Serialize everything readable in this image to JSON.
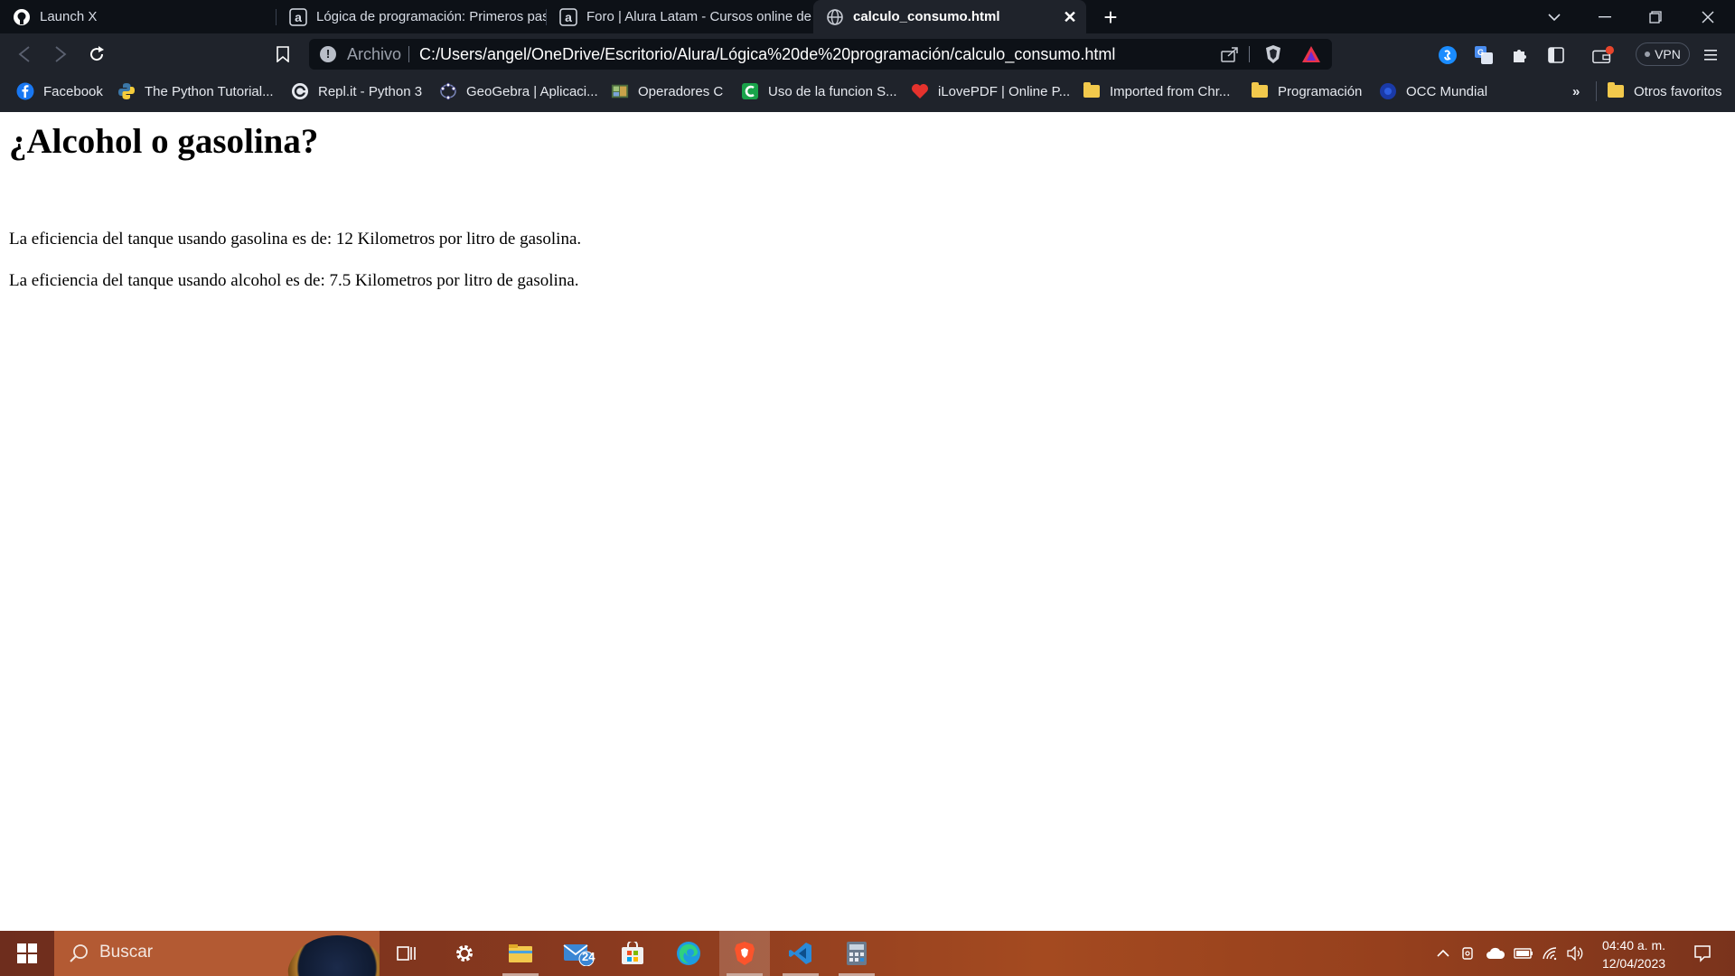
{
  "browser": {
    "tabs": [
      {
        "title": "Launch X",
        "icon": "github-icon",
        "active": false
      },
      {
        "title": "Lógica de programación: Primeros pas",
        "icon": "alura-icon",
        "active": false
      },
      {
        "title": "Foro | Alura Latam - Cursos online de t",
        "icon": "alura-icon",
        "active": false
      },
      {
        "title": "calculo_consumo.html",
        "icon": "globe-icon",
        "active": true
      }
    ],
    "address": {
      "scheme_label": "Archivo",
      "url": "C:/Users/angel/OneDrive/Escritorio/Alura/Lógica%20de%20programación/calculo_consumo.html"
    },
    "vpn_label": "VPN",
    "bookmarks": [
      {
        "label": "Facebook",
        "icon": "facebook-icon"
      },
      {
        "label": "The Python Tutorial...",
        "icon": "python-icon"
      },
      {
        "label": "Repl.it - Python 3",
        "icon": "replit-icon"
      },
      {
        "label": "GeoGebra | Aplicaci...",
        "icon": "geogebra-icon"
      },
      {
        "label": "Operadores C",
        "icon": "image-icon"
      },
      {
        "label": "Uso de la funcion S...",
        "icon": "c-icon"
      },
      {
        "label": "iLovePDF | Online P...",
        "icon": "heart-icon"
      },
      {
        "label": "Imported from Chr...",
        "icon": "folder-icon"
      },
      {
        "label": "Programación",
        "icon": "folder-icon"
      },
      {
        "label": "OCC Mundial",
        "icon": "occ-icon"
      }
    ],
    "bookmarks_overflow": "»",
    "other_bookmarks": "Otros favoritos"
  },
  "page": {
    "heading": "¿Alcohol o gasolina?",
    "paragraphs": [
      "La eficiencia del tanque usando gasolina es de: 12 Kilometros por litro de gasolina.",
      "La eficiencia del tanque usando alcohol es de: 7.5 Kilometros por litro de gasolina."
    ]
  },
  "taskbar": {
    "search_placeholder": "Buscar",
    "mail_badge": "24",
    "time": "04:40 a. m.",
    "date": "12/04/2023"
  },
  "colors": {
    "tabstrip": "#0d1117",
    "toolbar": "#1f232b",
    "brave_orange": "#fb542b",
    "vscode_blue": "#2a8ad8"
  }
}
